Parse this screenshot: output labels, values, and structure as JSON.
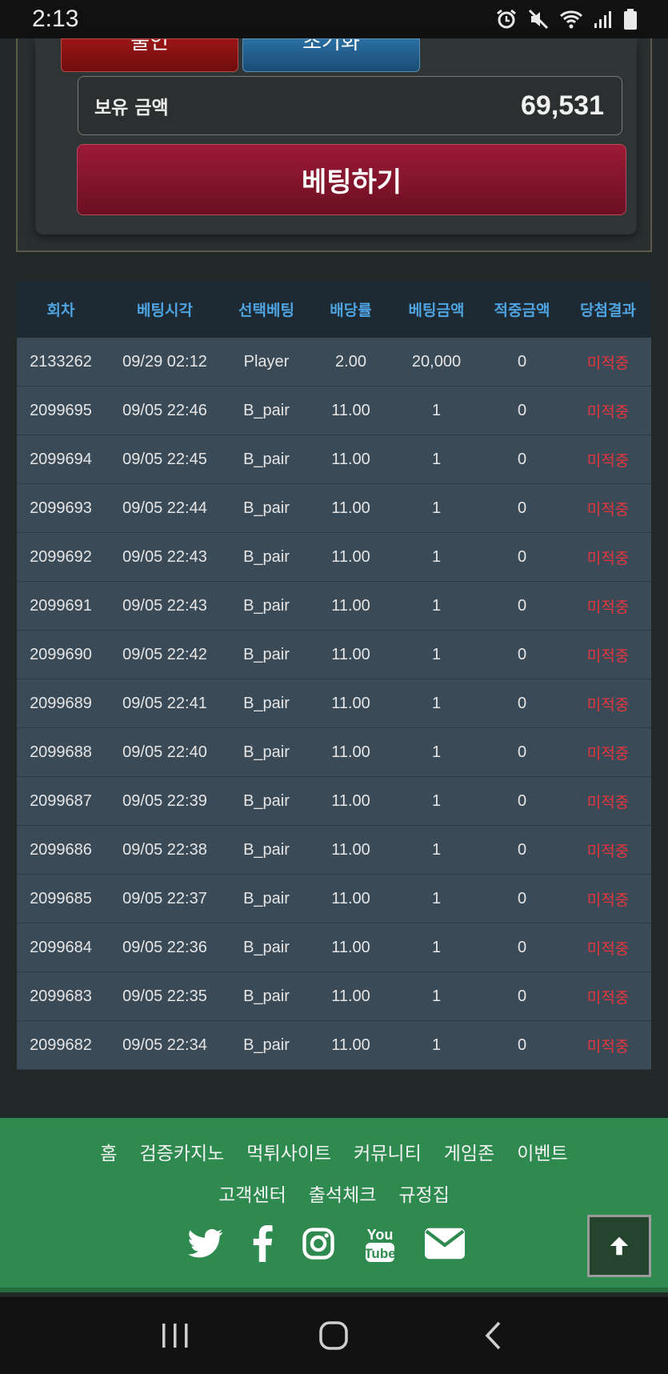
{
  "status_bar": {
    "time": "2:13",
    "icons": [
      "alarm-icon",
      "mute-icon",
      "wifi-icon",
      "signal-icon",
      "battery-icon"
    ]
  },
  "bet_panel": {
    "tab_red_label": "출인",
    "tab_blue_label": "초기화",
    "balance_label": "보유 금액",
    "balance_value": "69,531",
    "bet_button_label": "베팅하기"
  },
  "history": {
    "columns": [
      "회차",
      "베팅시각",
      "선택베팅",
      "배당률",
      "베팅금액",
      "적중금액",
      "당첨결과"
    ],
    "rows": [
      [
        "2133262",
        "09/29 02:12",
        "Player",
        "2.00",
        "20,000",
        "0",
        "미적중"
      ],
      [
        "2099695",
        "09/05 22:46",
        "B_pair",
        "11.00",
        "1",
        "0",
        "미적중"
      ],
      [
        "2099694",
        "09/05 22:45",
        "B_pair",
        "11.00",
        "1",
        "0",
        "미적중"
      ],
      [
        "2099693",
        "09/05 22:44",
        "B_pair",
        "11.00",
        "1",
        "0",
        "미적중"
      ],
      [
        "2099692",
        "09/05 22:43",
        "B_pair",
        "11.00",
        "1",
        "0",
        "미적중"
      ],
      [
        "2099691",
        "09/05 22:43",
        "B_pair",
        "11.00",
        "1",
        "0",
        "미적중"
      ],
      [
        "2099690",
        "09/05 22:42",
        "B_pair",
        "11.00",
        "1",
        "0",
        "미적중"
      ],
      [
        "2099689",
        "09/05 22:41",
        "B_pair",
        "11.00",
        "1",
        "0",
        "미적중"
      ],
      [
        "2099688",
        "09/05 22:40",
        "B_pair",
        "11.00",
        "1",
        "0",
        "미적중"
      ],
      [
        "2099687",
        "09/05 22:39",
        "B_pair",
        "11.00",
        "1",
        "0",
        "미적중"
      ],
      [
        "2099686",
        "09/05 22:38",
        "B_pair",
        "11.00",
        "1",
        "0",
        "미적중"
      ],
      [
        "2099685",
        "09/05 22:37",
        "B_pair",
        "11.00",
        "1",
        "0",
        "미적중"
      ],
      [
        "2099684",
        "09/05 22:36",
        "B_pair",
        "11.00",
        "1",
        "0",
        "미적중"
      ],
      [
        "2099683",
        "09/05 22:35",
        "B_pair",
        "11.00",
        "1",
        "0",
        "미적중"
      ],
      [
        "2099682",
        "09/05 22:34",
        "B_pair",
        "11.00",
        "1",
        "0",
        "미적중"
      ]
    ]
  },
  "footer": {
    "links": [
      "홈",
      "검증카지노",
      "먹튀사이트",
      "커뮤니티",
      "게임존",
      "이벤트",
      "고객센터",
      "출석체크",
      "규정집"
    ],
    "social_icons": [
      "twitter-icon",
      "facebook-icon",
      "instagram-icon",
      "youtube-icon",
      "mail-icon"
    ],
    "scroll_top_icon": "arrow-up-icon"
  },
  "nav_bar": {
    "buttons": [
      "recent-apps-icon",
      "home-icon",
      "back-icon"
    ]
  },
  "colors": {
    "table_header_text": "#4ea3e0",
    "result_text": "#e5363f",
    "footer_bg": "#2e8a4e",
    "bet_button": "#8b1630"
  }
}
